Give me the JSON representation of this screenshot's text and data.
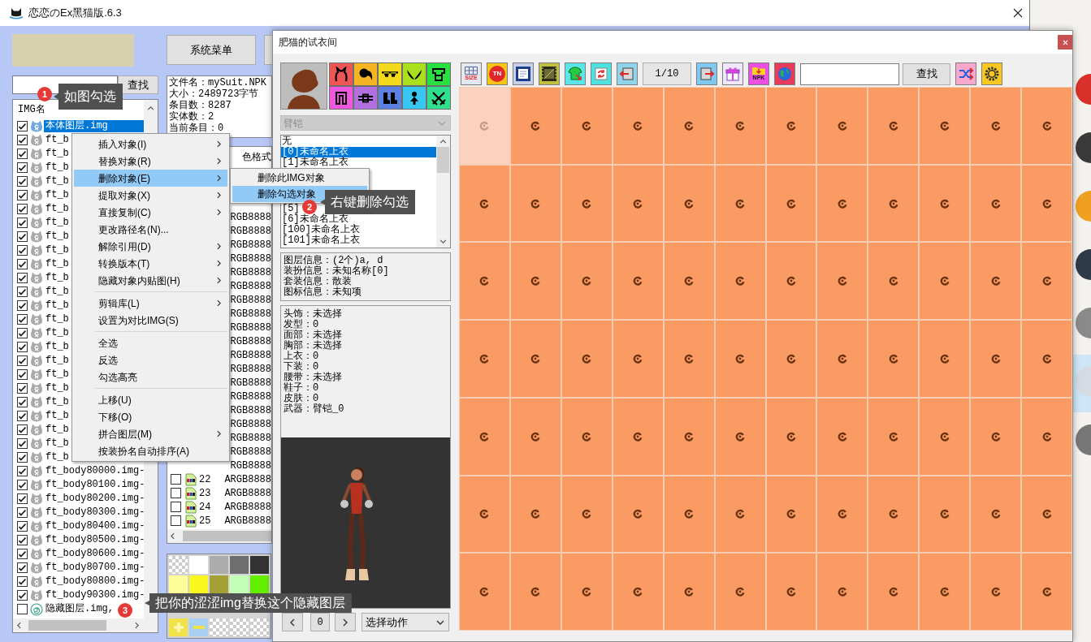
{
  "main_window": {
    "title": "恋恋のEx黑猫版.6.3",
    "search": {
      "button": "查找"
    },
    "system_menu_button": "系统菜单",
    "img_list": {
      "header": "IMG名",
      "rows": [
        {
          "kind": "body",
          "name": "本体图层.img",
          "checked": true,
          "selected": true
        },
        {
          "kind": "normal",
          "name": "ft_b",
          "checked": true,
          "selected": false
        },
        {
          "kind": "normal",
          "name": "ft_b",
          "checked": true,
          "selected": false
        },
        {
          "kind": "normal",
          "name": "ft_b",
          "checked": true,
          "selected": false
        },
        {
          "kind": "normal",
          "name": "ft_b",
          "checked": true,
          "selected": false
        },
        {
          "kind": "normal",
          "name": "ft_b",
          "checked": true,
          "selected": false
        },
        {
          "kind": "normal",
          "name": "ft_b",
          "checked": true,
          "selected": false
        },
        {
          "kind": "normal",
          "name": "ft_b",
          "checked": true,
          "selected": false
        },
        {
          "kind": "normal",
          "name": "ft_b",
          "checked": true,
          "selected": false
        },
        {
          "kind": "normal",
          "name": "ft_b",
          "checked": true,
          "selected": false
        },
        {
          "kind": "normal",
          "name": "ft_b",
          "checked": true,
          "selected": false
        },
        {
          "kind": "normal",
          "name": "ft_b",
          "checked": true,
          "selected": false
        },
        {
          "kind": "normal",
          "name": "ft_b",
          "checked": true,
          "selected": false
        },
        {
          "kind": "normal",
          "name": "ft_b",
          "checked": true,
          "selected": false
        },
        {
          "kind": "normal",
          "name": "ft_b",
          "checked": true,
          "selected": false
        },
        {
          "kind": "normal",
          "name": "ft_b",
          "checked": true,
          "selected": false
        },
        {
          "kind": "normal",
          "name": "ft_b",
          "checked": true,
          "selected": false
        },
        {
          "kind": "normal",
          "name": "ft_b",
          "checked": true,
          "selected": false
        },
        {
          "kind": "normal",
          "name": "ft_b",
          "checked": true,
          "selected": false
        },
        {
          "kind": "normal",
          "name": "ft_b",
          "checked": true,
          "selected": false
        },
        {
          "kind": "normal",
          "name": "ft_b",
          "checked": true,
          "selected": false
        },
        {
          "kind": "normal",
          "name": "ft_b",
          "checked": true,
          "selected": false
        },
        {
          "kind": "normal",
          "name": "ft_b",
          "checked": true,
          "selected": false
        },
        {
          "kind": "normal",
          "name": "ft_b",
          "checked": true,
          "selected": false
        },
        {
          "kind": "normal",
          "name": "ft_b",
          "checked": true,
          "selected": false
        },
        {
          "kind": "normal",
          "name": "ft_body80000.img-",
          "checked": true,
          "selected": false
        },
        {
          "kind": "normal",
          "name": "ft_body80100.img-",
          "checked": true,
          "selected": false
        },
        {
          "kind": "normal",
          "name": "ft_body80200.img-",
          "checked": true,
          "selected": false
        },
        {
          "kind": "normal",
          "name": "ft_body80300.img-",
          "checked": true,
          "selected": false
        },
        {
          "kind": "normal",
          "name": "ft_body80400.img-",
          "checked": true,
          "selected": false
        },
        {
          "kind": "normal",
          "name": "ft_body80500.img-",
          "checked": true,
          "selected": false
        },
        {
          "kind": "normal",
          "name": "ft_body80600.img-",
          "checked": true,
          "selected": false
        },
        {
          "kind": "normal",
          "name": "ft_body80700.img-",
          "checked": true,
          "selected": false
        },
        {
          "kind": "normal",
          "name": "ft_body80800.img-",
          "checked": true,
          "selected": false
        },
        {
          "kind": "normal",
          "name": "ft_body90300.img-",
          "checked": true,
          "selected": false
        },
        {
          "kind": "hidden",
          "name": "隐藏图层.img,",
          "checked": false,
          "selected": false
        }
      ]
    },
    "file_info": [
      "文件名：mySuit.NPK",
      "大小：2489723字节",
      "条目数：8287",
      "实体数：2",
      "当前条目：0"
    ],
    "frames_table": {
      "header": "色格式",
      "rows": [
        {
          "format": "RGB8888"
        },
        {
          "format": "RGB8888"
        },
        {
          "format": "RGB8888"
        },
        {
          "format": "RGB8888"
        },
        {
          "format": "RGB8888"
        },
        {
          "format": "RGB8888"
        },
        {
          "format": "RGB8888"
        },
        {
          "format": "RGB8888"
        },
        {
          "format": "RGB8888"
        },
        {
          "format": "RGB8888"
        },
        {
          "format": "RGB8888"
        },
        {
          "format": "RGB8888"
        },
        {
          "format": "RGB8888"
        },
        {
          "format": "RGB8888"
        },
        {
          "format": "RGB8888"
        },
        {
          "format": "RGB8888"
        },
        {
          "format": "RGB8888"
        },
        {
          "format": "RGB8888"
        },
        {
          "format": "RGB8888"
        },
        {
          "checked": false,
          "number": "22",
          "format": "ARGB8888"
        },
        {
          "checked": false,
          "number": "23",
          "format": "ARGB8888"
        },
        {
          "checked": false,
          "number": "24",
          "format": "ARGB8888"
        },
        {
          "checked": false,
          "number": "25",
          "format": "ARGB8888"
        }
      ]
    },
    "palette": [
      {
        "kind": "transparent"
      },
      {
        "kind": "swatch",
        "color": "#ffffff"
      },
      {
        "kind": "swatch",
        "color": "#acacac"
      },
      {
        "kind": "swatch",
        "color": "#6e6e6e"
      },
      {
        "kind": "swatch",
        "color": "#333333"
      },
      {
        "kind": "swatch",
        "color": "#fdfd9a"
      },
      {
        "kind": "swatch",
        "color": "#f8f820"
      },
      {
        "kind": "swatch",
        "color": "#a3a136"
      },
      {
        "kind": "swatch",
        "color": "#c3ffb4"
      },
      {
        "kind": "swatch",
        "color": "#62f000"
      },
      {
        "kind": "add"
      },
      {
        "kind": "remove"
      },
      {
        "kind": "transparent"
      },
      {
        "kind": "transparent"
      },
      {
        "kind": "transparent"
      }
    ]
  },
  "context_menu": {
    "items": [
      {
        "kind": "item",
        "label": "插入对象(I)",
        "submenu": true,
        "selected": false
      },
      {
        "kind": "item",
        "label": "替换对象(R)",
        "submenu": true,
        "selected": false
      },
      {
        "kind": "item",
        "label": "删除对象(E)",
        "submenu": true,
        "selected": true
      },
      {
        "kind": "item",
        "label": "提取对象(X)",
        "submenu": true,
        "selected": false
      },
      {
        "kind": "item",
        "label": "直接复制(C)",
        "submenu": true,
        "selected": false
      },
      {
        "kind": "item",
        "label": "更改路径名(N)...",
        "submenu": false,
        "selected": false
      },
      {
        "kind": "item",
        "label": "解除引用(D)",
        "submenu": true,
        "selected": false
      },
      {
        "kind": "item",
        "label": "转换版本(T)",
        "submenu": true,
        "selected": false
      },
      {
        "kind": "item",
        "label": "隐藏对象内贴图(H)",
        "submenu": true,
        "selected": false
      },
      {
        "kind": "separator"
      },
      {
        "kind": "item",
        "label": "剪辑库(L)",
        "submenu": true,
        "selected": false
      },
      {
        "kind": "item",
        "label": "设置为对比IMG(S)",
        "submenu": false,
        "selected": false
      },
      {
        "kind": "separator"
      },
      {
        "kind": "item",
        "label": "全选",
        "submenu": false,
        "selected": false
      },
      {
        "kind": "item",
        "label": "反选",
        "submenu": false,
        "selected": false
      },
      {
        "kind": "item",
        "label": "勾选高亮",
        "submenu": false,
        "selected": false
      },
      {
        "kind": "separator"
      },
      {
        "kind": "item",
        "label": "上移(U)",
        "submenu": false,
        "selected": false
      },
      {
        "kind": "item",
        "label": "下移(O)",
        "submenu": false,
        "selected": false
      },
      {
        "kind": "item",
        "label": "拼合图层(M)",
        "submenu": true,
        "selected": false
      },
      {
        "kind": "item",
        "label": "按装扮名自动排序(A)",
        "submenu": false,
        "selected": false
      }
    ]
  },
  "submenu": {
    "items": [
      {
        "label": "删除此IMG对象",
        "selected": false
      },
      {
        "label": "删除勾选对象",
        "selected": true
      }
    ]
  },
  "fitting_room": {
    "title": "肥猫的试衣间",
    "categories": [
      {
        "kind": "headgear",
        "color": "#ee5555"
      },
      {
        "kind": "hair",
        "color": "#f5b523"
      },
      {
        "kind": "glasses",
        "color": "#f2d91e"
      },
      {
        "kind": "wings",
        "color": "#a8e01c"
      },
      {
        "kind": "top",
        "color": "#28e040"
      },
      {
        "kind": "pants",
        "color": "#ef58de"
      },
      {
        "kind": "belt",
        "color": "#b070e0"
      },
      {
        "kind": "shoes",
        "color": "#5a80e2"
      },
      {
        "kind": "body",
        "color": "#38c6f2"
      },
      {
        "kind": "weapon",
        "color": "#30e08e"
      }
    ],
    "part_select": {
      "value": "臂铠",
      "disabled": true
    },
    "item_list": [
      {
        "label": "无",
        "selected": false
      },
      {
        "label": "[0]未命名上衣",
        "selected": true
      },
      {
        "label": "[1]未命名上衣",
        "selected": false
      },
      {
        "label": "[5]",
        "selected": false
      },
      {
        "label": "[6]未命名上衣",
        "selected": false
      },
      {
        "label": "[100]未命名上衣",
        "selected": false
      },
      {
        "label": "[101]未命名上衣",
        "selected": false
      }
    ],
    "layer_info": [
      "图层信息：(2个)a, d",
      "装扮信息：未知名称[0]",
      "套装信息：散装",
      "图标信息：未知项"
    ],
    "equipment": [
      "头饰：未选择",
      "发型：0",
      "面部：未选择",
      "胸部：未选择",
      "上衣：0",
      "下装：0",
      "腰带：未选择",
      "鞋子：0",
      "皮肤：0",
      "武器：臂铠_0"
    ],
    "frame": "0",
    "action_select": "选择动作",
    "toolbar": {
      "tools": [
        {
          "kind": "size",
          "label": "SIZE"
        },
        {
          "kind": "tn",
          "label": "TN"
        },
        {
          "kind": "frame"
        },
        {
          "kind": "film"
        },
        {
          "kind": "shirt"
        },
        {
          "kind": "refresh"
        },
        {
          "kind": "export"
        }
      ],
      "page": "1/10",
      "more_tools": [
        {
          "kind": "import"
        },
        {
          "kind": "gift"
        },
        {
          "kind": "npk",
          "label": "NPK"
        },
        {
          "kind": "globe"
        }
      ],
      "search_button": "查找",
      "end_tools": [
        {
          "kind": "shuffle"
        },
        {
          "kind": "settings"
        }
      ]
    },
    "tiles": [
      {
        "selected": true
      },
      {
        "selected": false
      },
      {
        "selected": false
      },
      {
        "selected": false
      },
      {
        "selected": false
      },
      {
        "selected": false
      },
      {
        "selected": false
      },
      {
        "selected": false
      },
      {
        "selected": false
      },
      {
        "selected": false
      },
      {
        "selected": false
      },
      {
        "selected": false
      },
      {
        "selected": false
      },
      {
        "selected": false
      },
      {
        "selected": false
      },
      {
        "selected": false
      },
      {
        "selected": false
      },
      {
        "selected": false
      },
      {
        "selected": false
      },
      {
        "selected": false
      },
      {
        "selected": false
      },
      {
        "selected": false
      },
      {
        "selected": false
      },
      {
        "selected": false
      },
      {
        "selected": false
      },
      {
        "selected": false
      },
      {
        "selected": false
      },
      {
        "selected": false
      },
      {
        "selected": false
      },
      {
        "selected": false
      },
      {
        "selected": false
      },
      {
        "selected": false
      },
      {
        "selected": false
      },
      {
        "selected": false
      },
      {
        "selected": false
      },
      {
        "selected": false
      },
      {
        "selected": false
      },
      {
        "selected": false
      },
      {
        "selected": false
      },
      {
        "selected": false
      },
      {
        "selected": false
      },
      {
        "selected": false
      },
      {
        "selected": false
      },
      {
        "selected": false
      },
      {
        "selected": false
      },
      {
        "selected": false
      },
      {
        "selected": false
      },
      {
        "selected": false
      },
      {
        "selected": false
      },
      {
        "selected": false
      },
      {
        "selected": false
      },
      {
        "selected": false
      },
      {
        "selected": false
      },
      {
        "selected": false
      },
      {
        "selected": false
      },
      {
        "selected": false
      },
      {
        "selected": false
      },
      {
        "selected": false
      },
      {
        "selected": false
      },
      {
        "selected": false
      },
      {
        "selected": false
      },
      {
        "selected": false
      },
      {
        "selected": false
      },
      {
        "selected": false
      },
      {
        "selected": false
      },
      {
        "selected": false
      },
      {
        "selected": false
      },
      {
        "selected": false
      },
      {
        "selected": false
      },
      {
        "selected": false
      },
      {
        "selected": false
      },
      {
        "selected": false
      },
      {
        "selected": false
      },
      {
        "selected": false
      },
      {
        "selected": false
      },
      {
        "selected": false
      },
      {
        "selected": false
      },
      {
        "selected": false
      },
      {
        "selected": false
      },
      {
        "selected": false
      },
      {
        "selected": false
      },
      {
        "selected": false
      },
      {
        "selected": false
      },
      {
        "selected": false
      }
    ]
  },
  "annotations": [
    {
      "number": "1",
      "text": "如图勾选"
    },
    {
      "number": "2",
      "text": "右键删除勾选"
    },
    {
      "number": "3",
      "text": "把你的涩涩img替换这个隐藏图层"
    }
  ]
}
